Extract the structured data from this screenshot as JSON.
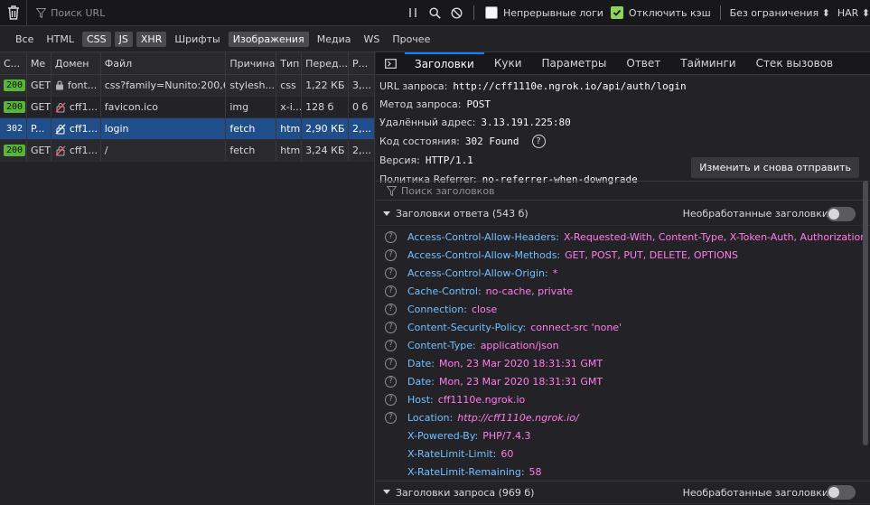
{
  "toolbar": {
    "filter_placeholder": "Поиск URL",
    "persist_logs": "Непрерывные логи",
    "disable_cache": "Отключить кэш",
    "throttling": "Без ограничения ⬍",
    "har": "HAR ⬍"
  },
  "filters": [
    "Все",
    "HTML",
    "CSS",
    "JS",
    "XHR",
    "Шрифты",
    "Изображения",
    "Медиа",
    "WS",
    "Прочее"
  ],
  "active_filters": [
    "CSS",
    "JS",
    "XHR",
    "Изображения"
  ],
  "columns": [
    "С...",
    "Ме",
    "Домен",
    "Файл",
    "Причина",
    "Тип",
    "Перед...",
    "Р..."
  ],
  "requests": [
    {
      "status": "200",
      "method": "GET",
      "domain": "font...",
      "file": "css?family=Nunito:200,600",
      "cause": "stylesh...",
      "type": "css",
      "transferred": "1,22 КБ",
      "size": "3,..."
    },
    {
      "status": "200",
      "method": "GET",
      "domain": "cff1...",
      "file": "favicon.ico",
      "cause": "img",
      "type": "x-i...",
      "transferred": "128 б",
      "size": "0 б"
    },
    {
      "status": "302",
      "method": "P...",
      "domain": "cff1...",
      "file": "login",
      "cause": "fetch",
      "type": "html",
      "transferred": "2,90 КБ",
      "size": "2,..."
    },
    {
      "status": "200",
      "method": "GET",
      "domain": "cff1...",
      "file": "/",
      "cause": "fetch",
      "type": "html",
      "transferred": "3,24 КБ",
      "size": "2,..."
    }
  ],
  "tabs": [
    "Заголовки",
    "Куки",
    "Параметры",
    "Ответ",
    "Тайминги",
    "Стек вызовов"
  ],
  "summary": {
    "url_label": "URL запроса:",
    "url": "http://cff1110e.ngrok.io/api/auth/login",
    "method_label": "Метод запроса:",
    "method": "POST",
    "remote_label": "Удалённый адрес:",
    "remote": "3.13.191.225:80",
    "status_label": "Код состояния:",
    "status": "302 Found",
    "version_label": "Версия:",
    "version": "HTTP/1.1",
    "referrer_label": "Политика Referrer:",
    "referrer": "no-referrer-when-downgrade"
  },
  "resend_label": "Изменить и снова отправить",
  "search_headers": "Поиск заголовков",
  "response_section": "Заголовки ответа (543 б)",
  "request_section": "Заголовки запроса (969 б)",
  "raw_headers": "Необработанные заголовки",
  "response_headers": [
    {
      "name": "Access-Control-Allow-Headers:",
      "value": "X-Requested-With, Content-Type, X-Token-Auth, Authorization",
      "help": true
    },
    {
      "name": "Access-Control-Allow-Methods:",
      "value": "GET, POST, PUT, DELETE, OPTIONS",
      "help": true
    },
    {
      "name": "Access-Control-Allow-Origin:",
      "value": "*",
      "help": true
    },
    {
      "name": "Cache-Control:",
      "value": "no-cache, private",
      "help": true
    },
    {
      "name": "Connection:",
      "value": "close",
      "help": true
    },
    {
      "name": "Content-Security-Policy:",
      "value": "connect-src 'none'",
      "help": true
    },
    {
      "name": "Content-Type:",
      "value": "application/json",
      "help": true
    },
    {
      "name": "Date:",
      "value": "Mon, 23 Mar 2020 18:31:31 GMT",
      "help": true
    },
    {
      "name": "Date:",
      "value": "Mon, 23 Mar 2020 18:31:31 GMT",
      "help": true
    },
    {
      "name": "Host:",
      "value": "cff1110e.ngrok.io",
      "help": true
    },
    {
      "name": "Location:",
      "value": "http://cff1110e.ngrok.io/",
      "help": true,
      "italic": true
    },
    {
      "name": "X-Powered-By:",
      "value": "PHP/7.4.3",
      "help": false
    },
    {
      "name": "X-RateLimit-Limit:",
      "value": "60",
      "help": false
    },
    {
      "name": "X-RateLimit-Remaining:",
      "value": "58",
      "help": false
    }
  ],
  "colors": {
    "accent": "#0a84ff",
    "selected_row": "#204e8a",
    "header_name": "#75bfff",
    "header_value": "#ff7de9",
    "status_ok": "#58b636"
  }
}
